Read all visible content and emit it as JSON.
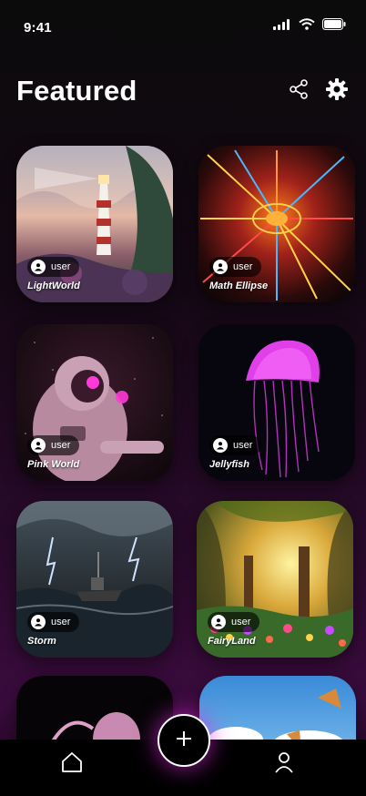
{
  "status": {
    "time": "9:41",
    "icons": [
      "cellular-signal-icon",
      "wifi-icon",
      "battery-icon"
    ]
  },
  "header": {
    "title": "Featured",
    "actions": [
      "share-icon",
      "settings-gear-icon"
    ]
  },
  "cards": [
    {
      "title": "LightWorld",
      "user": "user"
    },
    {
      "title": "Math Ellipse",
      "user": "user"
    },
    {
      "title": "Pink World",
      "user": "user"
    },
    {
      "title": "Jellyfish",
      "user": "user"
    },
    {
      "title": "Storm",
      "user": "user"
    },
    {
      "title": "FairyLand",
      "user": "user"
    }
  ],
  "tabbar": {
    "items": [
      "home-icon",
      "add-icon",
      "profile-icon"
    ]
  },
  "colors": {
    "accent_glow": "#dc28dc",
    "background_bottom": "#3a0b3d"
  }
}
